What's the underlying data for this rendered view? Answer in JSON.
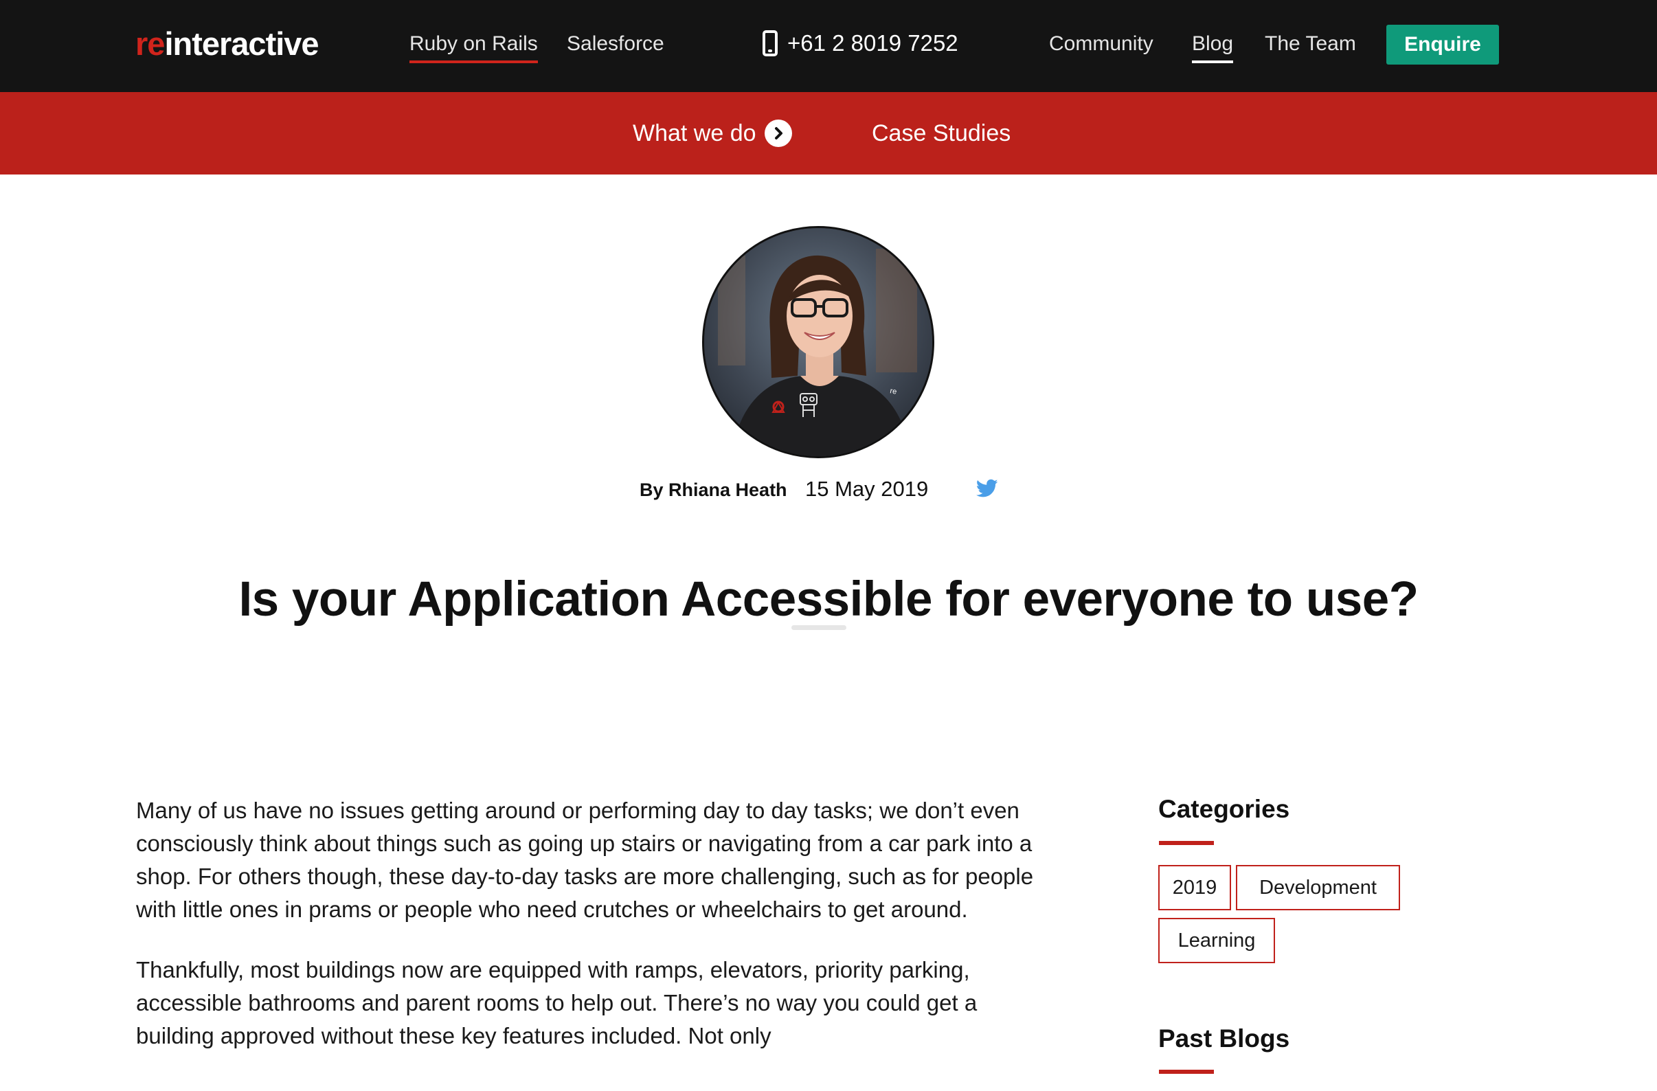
{
  "brand": {
    "logo_prefix": "re",
    "logo_suffix": "interactive"
  },
  "nav": {
    "left_links": [
      "Ruby on Rails",
      "Salesforce"
    ],
    "phone": "+61 2 8019 7252",
    "right_links": [
      "Community",
      "Blog",
      "The Team"
    ],
    "enquire_label": "Enquire"
  },
  "subnav": {
    "what_we_do": "What we do",
    "case_studies": "Case Studies"
  },
  "post": {
    "author": "By Rhiana Heath",
    "date": "15 May 2019",
    "title": "Is your Application Accessible for everyone to use?",
    "paragraphs": [
      "Many of us have no issues getting around or performing day to day tasks; we don’t even consciously think about things such as going up stairs or navigating from a car park into a shop. For others though, these day-to-day tasks are more challenging, such as for people with little ones in prams or people who need crutches or wheelchairs to get around.",
      "Thankfully, most buildings now are equipped with ramps, elevators, priority parking, accessible bathrooms and parent rooms to help out. There’s no way you could get a building approved without these key features included. Not only"
    ]
  },
  "sidebar": {
    "categories_heading": "Categories",
    "categories": [
      "2019",
      "Development",
      "Learning"
    ],
    "past_blogs_heading": "Past Blogs"
  },
  "colors": {
    "topbar": "#141414",
    "brand_red": "#bb211b",
    "enquire_green": "#0f9a7a",
    "twitter_blue": "#4a9ee8"
  },
  "icons": [
    "phone-icon",
    "chevron-right-icon",
    "twitter-icon"
  ]
}
